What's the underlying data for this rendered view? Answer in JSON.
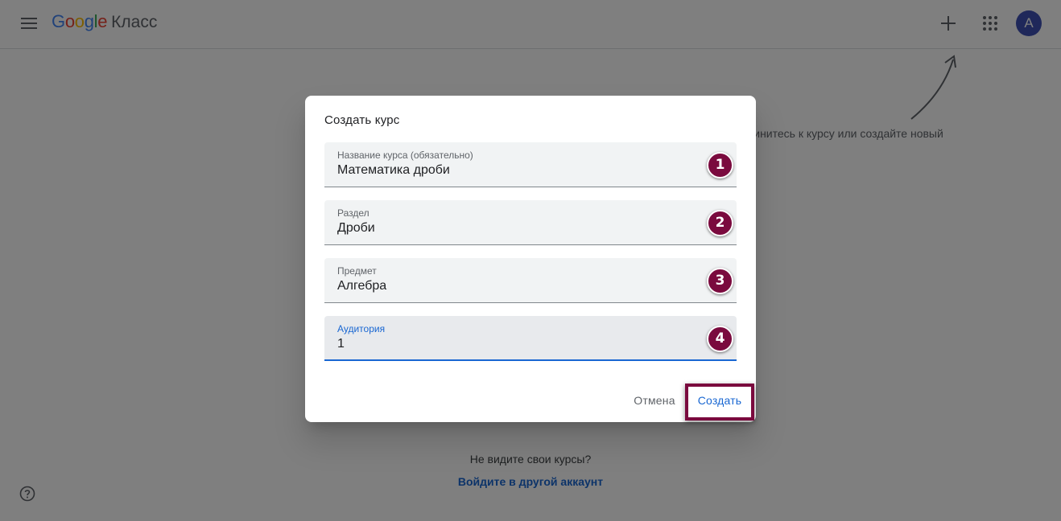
{
  "app": {
    "logo_google": "Google",
    "logo_product": "Класс",
    "avatar_letter": "A",
    "brand_colors": {
      "blue": "#4285F4",
      "red": "#EA4335",
      "yellow": "#FBBC05",
      "green": "#34A853"
    }
  },
  "topbar": {
    "menu_icon": "hamburger-menu-icon",
    "plus_icon": "plus-icon",
    "apps_icon": "apps-grid-icon"
  },
  "page": {
    "hint_text": "Присоединитесь к курсу или создайте новый",
    "missing_courses_text": "Не видите свои курсы?",
    "switch_account_link": "Войдите в другой аккаунт",
    "help_icon": "help-icon"
  },
  "dialog": {
    "title": "Создать курс",
    "fields": [
      {
        "label": "Название курса (обязательно)",
        "value": "Математика дроби",
        "step": "1"
      },
      {
        "label": "Раздел",
        "value": "Дроби",
        "step": "2"
      },
      {
        "label": "Предмет",
        "value": "Алгебра",
        "step": "3"
      },
      {
        "label": "Аудитория",
        "value": "1",
        "step": "4"
      }
    ],
    "cancel_label": "Отмена",
    "create_label": "Создать"
  },
  "colors": {
    "accent": "#1967d2",
    "annotation": "#7a0a3e",
    "avatar": "#3f51b5"
  }
}
